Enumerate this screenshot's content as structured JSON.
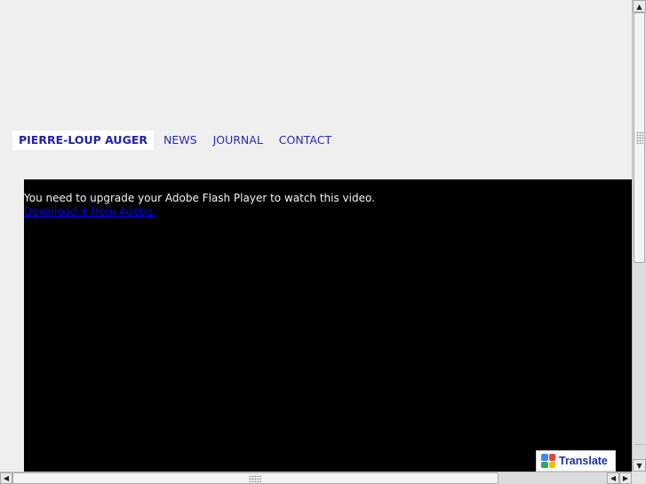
{
  "nav": {
    "brand": "PIERRE-LOUP AUGER",
    "items": [
      {
        "label": "NEWS"
      },
      {
        "label": "JOURNAL"
      },
      {
        "label": "CONTACT"
      }
    ]
  },
  "video": {
    "message": "You need to upgrade your Adobe Flash Player to watch this video.",
    "link_text": "Download it from Adobe."
  },
  "translate": {
    "label": "Translate",
    "icon": "google-translate-icon"
  },
  "scrollbars": {
    "up_icon": "arrow-up-icon",
    "down_icon": "arrow-down-icon",
    "left_icon": "arrow-left-icon",
    "right_icon": "arrow-right-icon"
  },
  "colors": {
    "background": "#efefef",
    "nav_text": "#2a2ab8",
    "video_bg": "#000000",
    "link": "#0000ee"
  }
}
